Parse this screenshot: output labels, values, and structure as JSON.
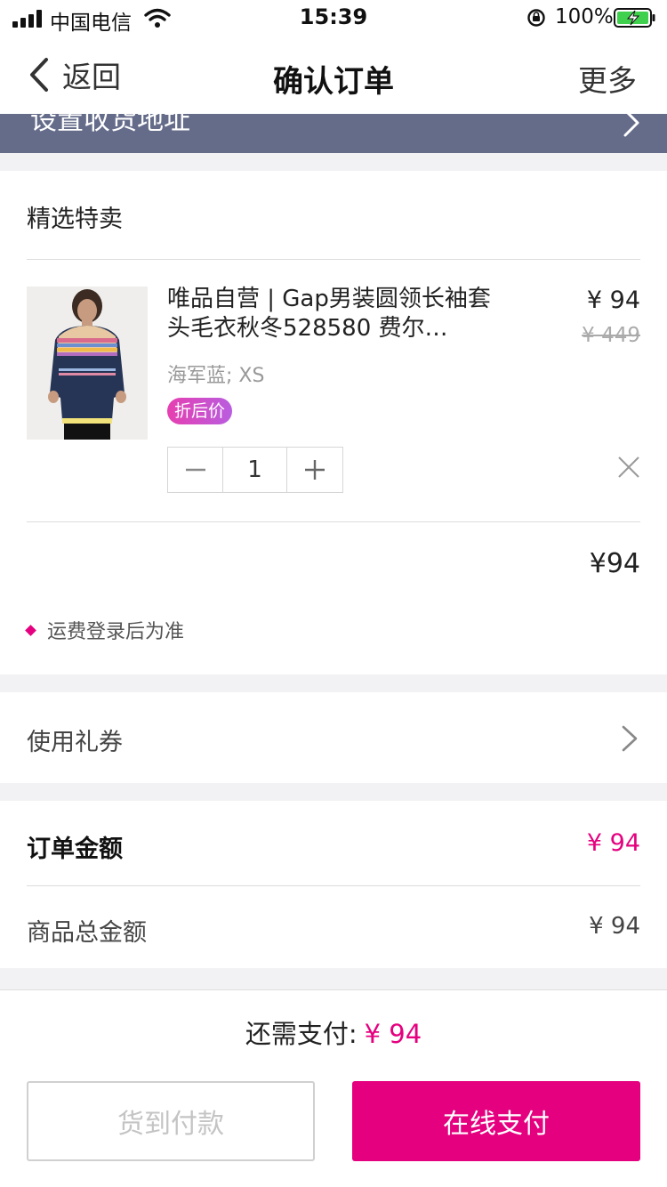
{
  "status_bar": {
    "carrier": "中国电信",
    "time": "15:39",
    "battery": "100%"
  },
  "nav": {
    "back_label": "返回",
    "title": "确认订单",
    "more_label": "更多"
  },
  "address": {
    "label": "设置收货地址"
  },
  "product_section": {
    "title": "精选特卖",
    "item": {
      "name": "唯品自营 | Gap男装圆领长袖套头毛衣秋冬528580 费尔…",
      "price": "¥ 94",
      "original_price": "¥ 449",
      "sku": "海军蓝; XS",
      "badge": "折后价",
      "quantity": "1"
    },
    "subtotal": "¥94",
    "shipping_note": "运费登录后为准"
  },
  "coupon": {
    "label": "使用礼券"
  },
  "totals": {
    "order_label": "订单金额",
    "order_value": "¥ 94",
    "goods_label": "商品总金额",
    "goods_value": "¥ 94"
  },
  "bottom": {
    "pay_label": "还需支付:",
    "pay_amount": "¥ 94",
    "cod_button": "货到付款",
    "online_button": "在线支付"
  },
  "colors": {
    "accent": "#e5007f",
    "address_bar": "#656c8a"
  }
}
